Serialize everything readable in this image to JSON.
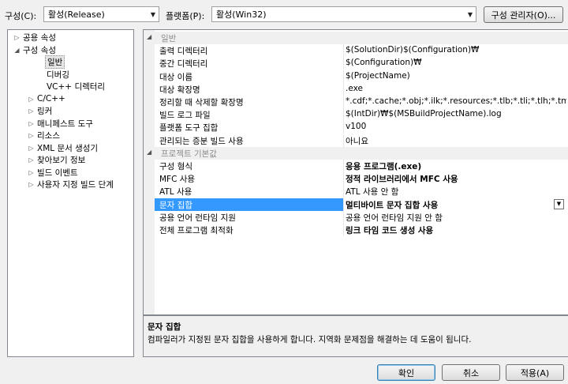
{
  "toolbar": {
    "config_label": "구성(C):",
    "config_value": "활성(Release)",
    "platform_label": "플랫폼(P):",
    "platform_value": "활성(Win32)",
    "config_manager_label": "구성 관리자(O)..."
  },
  "tree": {
    "items": [
      {
        "label": "공용 속성",
        "toggle": "▷"
      },
      {
        "label": "구성 속성",
        "toggle": "◢"
      },
      {
        "label": "일반",
        "toggle": ""
      },
      {
        "label": "디버깅",
        "toggle": ""
      },
      {
        "label": "VC++ 디렉터리",
        "toggle": ""
      },
      {
        "label": "C/C++",
        "toggle": "▷"
      },
      {
        "label": "링커",
        "toggle": "▷"
      },
      {
        "label": "매니페스트 도구",
        "toggle": "▷"
      },
      {
        "label": "리소스",
        "toggle": "▷"
      },
      {
        "label": "XML 문서 생성기",
        "toggle": "▷"
      },
      {
        "label": "찾아보기 정보",
        "toggle": "▷"
      },
      {
        "label": "빌드 이벤트",
        "toggle": "▷"
      },
      {
        "label": "사용자 지정 빌드 단계",
        "toggle": "▷"
      }
    ]
  },
  "grid": {
    "sections": [
      {
        "title": "일반",
        "toggle": "◢",
        "rows": [
          {
            "name": "출력 디렉터리",
            "value": "$(SolutionDir)$(Configuration)₩"
          },
          {
            "name": "중간 디렉터리",
            "value": "$(Configuration)₩"
          },
          {
            "name": "대상 이름",
            "value": "$(ProjectName)"
          },
          {
            "name": "대상 확장명",
            "value": ".exe"
          },
          {
            "name": "정리할 때 삭제할 확장명",
            "value": "*.cdf;*.cache;*.obj;*.ilk;*.resources;*.tlb;*.tli;*.tlh;*.tmp;*.rsp;"
          },
          {
            "name": "빌드 로그 파일",
            "value": "$(IntDir)₩$(MSBuildProjectName).log"
          },
          {
            "name": "플랫폼 도구 집합",
            "value": "v100"
          },
          {
            "name": "관리되는 증분 빌드 사용",
            "value": "아니요"
          }
        ]
      },
      {
        "title": "프로젝트 기본값",
        "toggle": "◢",
        "rows": [
          {
            "name": "구성 형식",
            "value": "응용 프로그램(.exe)"
          },
          {
            "name": "MFC 사용",
            "value": "정적 라이브러리에서 MFC 사용"
          },
          {
            "name": "ATL 사용",
            "value": "ATL 사용 안 함"
          },
          {
            "name": "문자 집합",
            "value": "멀티바이트 문자 집합 사용"
          },
          {
            "name": "공용 언어 런타임 지원",
            "value": "공용 언어 런타임 지원 안 함"
          },
          {
            "name": "전체 프로그램 최적화",
            "value": "링크 타임 코드 생성 사용"
          }
        ]
      }
    ],
    "dropdown_icon": "▼"
  },
  "description": {
    "title": "문자 집합",
    "body": "컴파일러가 지정된 문자 집합을 사용하게 합니다. 지역화 문제점을 해결하는 데 도움이 됩니다."
  },
  "buttons": {
    "ok": "확인",
    "cancel": "취소",
    "apply": "적용(A)"
  },
  "colors": {
    "selection": "#3399ff",
    "background": "#f0f0f0"
  }
}
